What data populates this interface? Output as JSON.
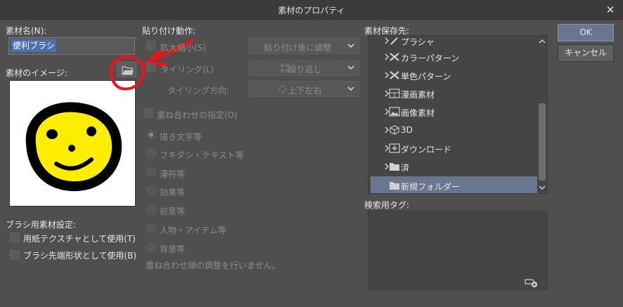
{
  "window": {
    "title": "素材のプロパティ",
    "close_glyph": "✕"
  },
  "material_name": {
    "label": "素材名(N):",
    "value": "便利ブラシ"
  },
  "material_image": {
    "label": "素材のイメージ:"
  },
  "brush_settings": {
    "label": "ブラシ用素材設定:",
    "paper_texture": "用紙テクスチャとして使用(T)",
    "tip_shape": "ブラシ先端形状として使用(B)"
  },
  "paste": {
    "label": "貼り付け動作:",
    "scale_label": "拡大縮小(S)",
    "scale_value": "貼り付け後に調整",
    "tiling_label": "タイリング(L)",
    "tiling_value": "繰り返し",
    "tiling_dir_label": "タイリング方向:",
    "tiling_dir_value": "上下左右"
  },
  "overlay": {
    "label": "重ね合わせの指定(O)",
    "options": [
      "描き文字等",
      "フキダシ・テキスト等",
      "漫符等",
      "効果等",
      "前景等",
      "人物・アイテム等",
      "背景等"
    ],
    "note": "重ね合わせ順の調整を行いません。"
  },
  "save_dest": {
    "label": "素材保存先:",
    "items": [
      {
        "label": "プラシャ"
      },
      {
        "label": "カラーパターン"
      },
      {
        "label": "単色パターン"
      },
      {
        "label": "漫画素材"
      },
      {
        "label": "画像素材"
      },
      {
        "label": "3D"
      },
      {
        "label": "ダウンロード"
      },
      {
        "label": "済"
      },
      {
        "label": "新規フォルダー"
      }
    ]
  },
  "search_tag": {
    "label": "検索用タグ:"
  },
  "buttons": {
    "ok": "OK",
    "cancel": "キャンセル"
  },
  "colors": {
    "accent": "#6a7590",
    "annotation": "#e8161c",
    "smiley": "#ffed00"
  }
}
